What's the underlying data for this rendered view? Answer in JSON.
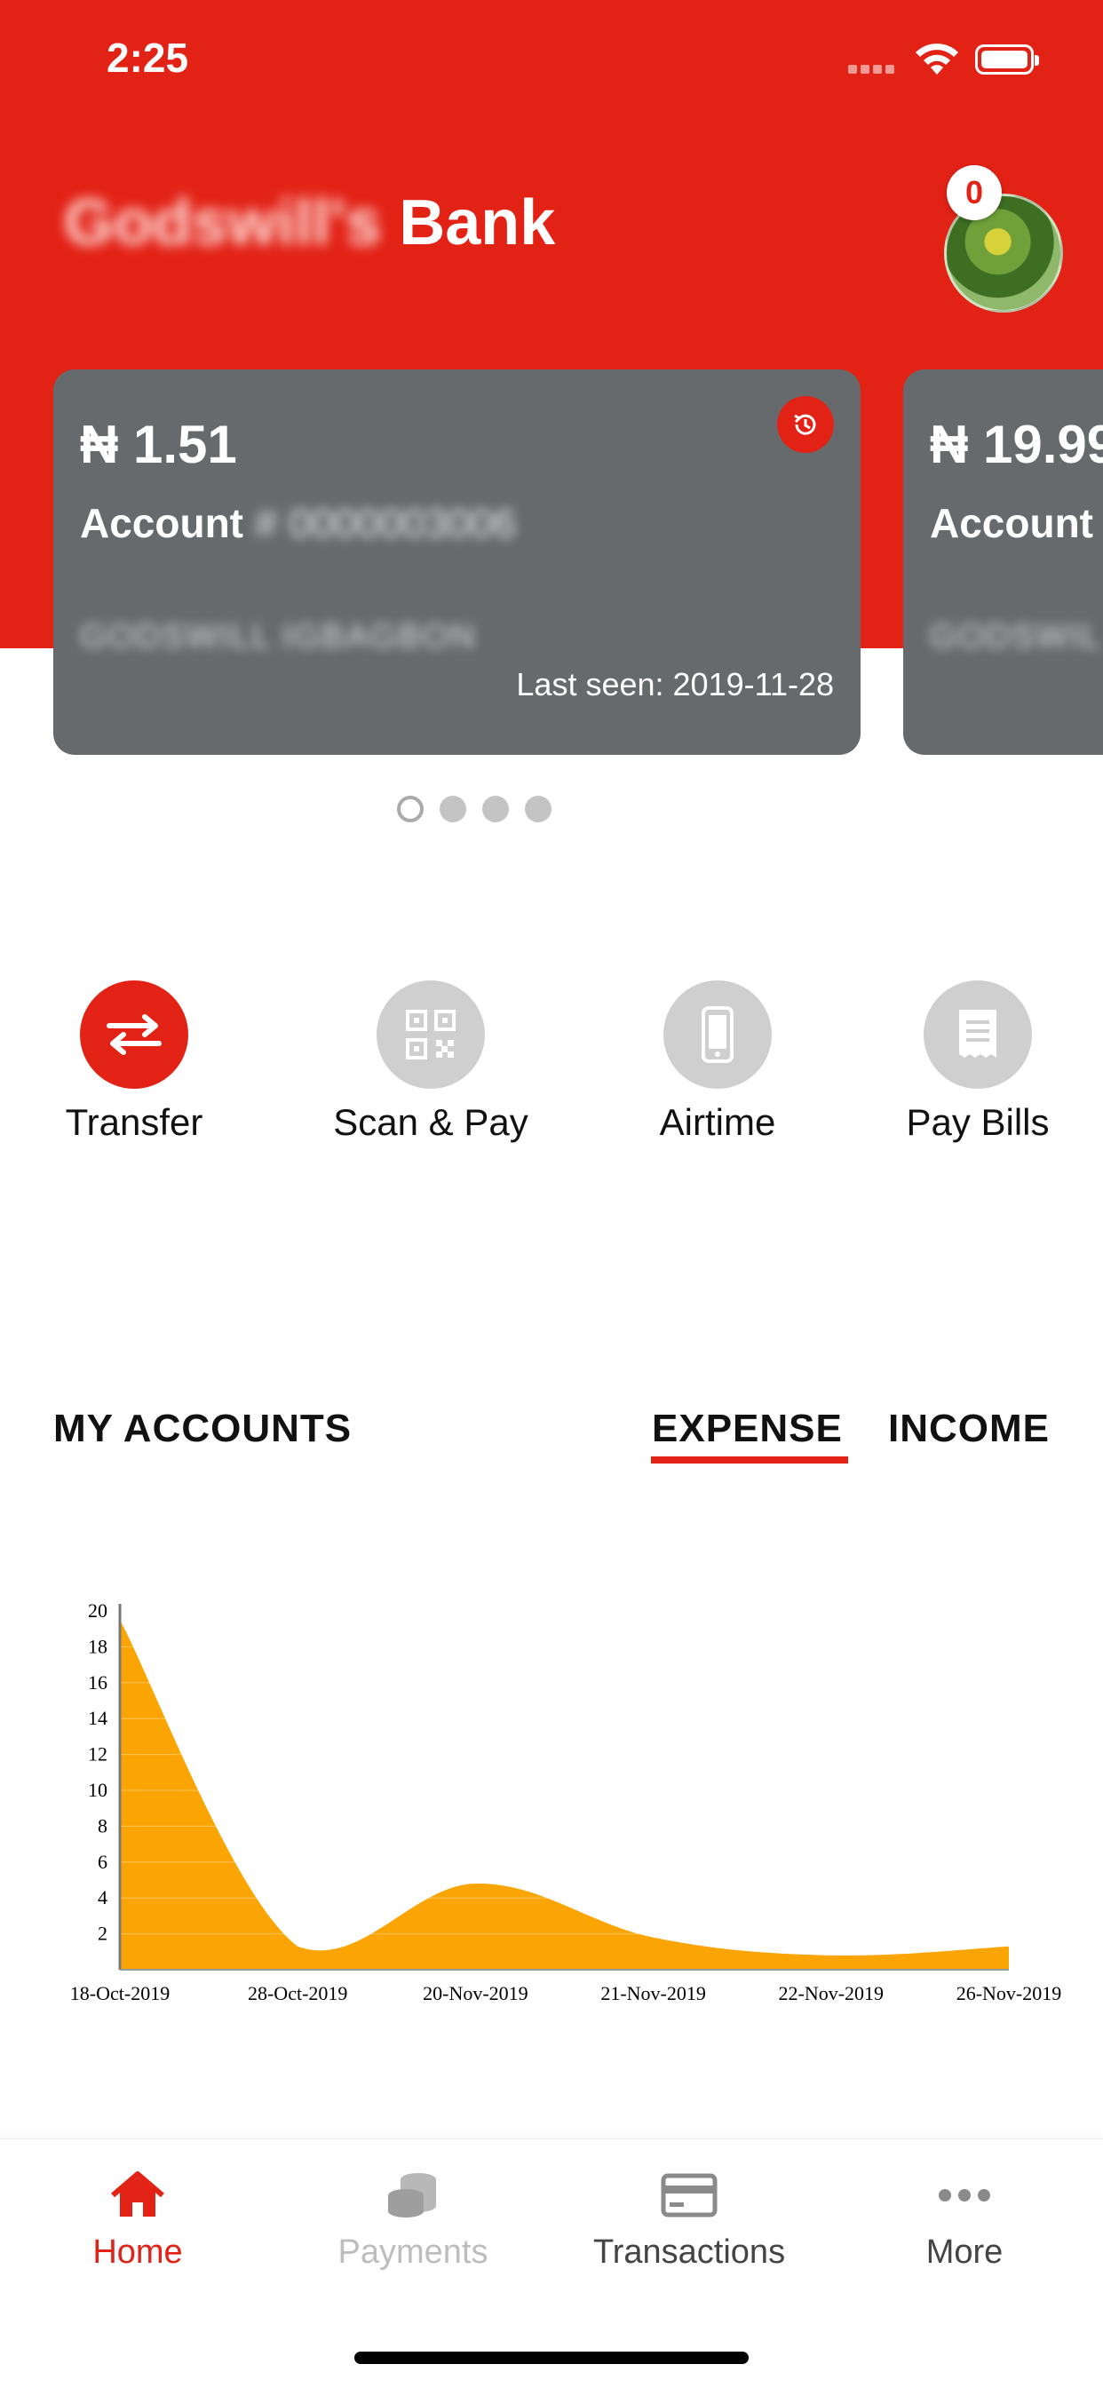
{
  "status_bar": {
    "time": "2:25"
  },
  "header": {
    "title_blurred": "Godswill's",
    "title": "Bank",
    "notification_count": "0"
  },
  "accounts": [
    {
      "amount": "₦ 1.51",
      "account_label": "Account",
      "account_number": "# 0000003006",
      "owner": "GODSWILL IGBAGBON",
      "last_seen": "Last seen: 2019-11-28"
    },
    {
      "amount": "₦ 19.99",
      "account_label": "Account",
      "owner": "GODSWIL"
    }
  ],
  "pager": {
    "count": 4,
    "active_index": 0
  },
  "actions": [
    {
      "label": "Transfer",
      "icon": "transfer-arrows-icon"
    },
    {
      "label": "Scan & Pay",
      "icon": "qr-code-icon"
    },
    {
      "label": "Airtime",
      "icon": "phone-icon"
    },
    {
      "label": "Pay Bills",
      "icon": "receipt-icon"
    }
  ],
  "accounts_section": {
    "title": "MY ACCOUNTS",
    "tabs": [
      "EXPENSE",
      "INCOME"
    ],
    "active_tab": "EXPENSE"
  },
  "chart_data": {
    "type": "area",
    "categories": [
      "18-Oct-2019",
      "28-Oct-2019",
      "20-Nov-2019",
      "21-Nov-2019",
      "22-Nov-2019",
      "26-Nov-2019"
    ],
    "values": [
      19.5,
      1.3,
      4.8,
      1.8,
      0.8,
      1.3
    ],
    "y_ticks": [
      2,
      4,
      6,
      8,
      10,
      12,
      14,
      16,
      18,
      20
    ],
    "ylim": [
      0,
      20
    ],
    "grid": true,
    "fill_color": "#fba504"
  },
  "bottom_nav": [
    {
      "label": "Home",
      "icon": "home-icon",
      "state": "active"
    },
    {
      "label": "Payments",
      "icon": "coins-icon",
      "state": "disabled"
    },
    {
      "label": "Transactions",
      "icon": "card-icon",
      "state": "normal"
    },
    {
      "label": "More",
      "icon": "more-dots-icon",
      "state": "normal"
    }
  ],
  "colors": {
    "brand_red": "#e32216",
    "card_gray": "#666a6d",
    "chart_fill": "#fba504"
  }
}
